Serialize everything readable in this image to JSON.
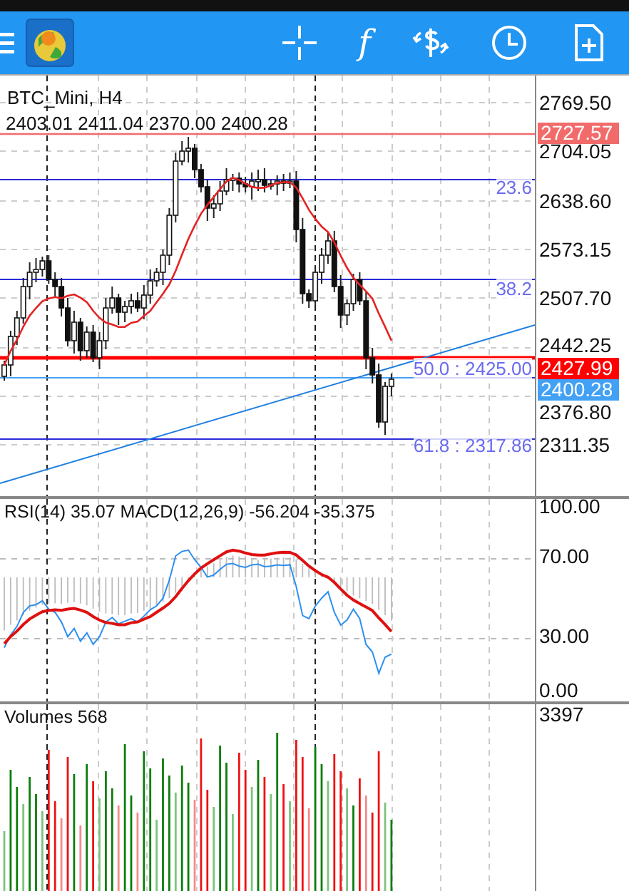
{
  "toolbar": {
    "function_glyph": "f"
  },
  "chart": {
    "symbol": "BTC_Mini, H4",
    "ohlc": "2403.01 2411.04 2370.00 2400.28",
    "price_ticks": [
      "2769.50",
      "2704.05",
      "2638.60",
      "2573.15",
      "2507.70",
      "2442.25",
      "2376.80",
      "2311.35"
    ],
    "price_tags": [
      {
        "text": "2727.57",
        "color": "#f26b6b"
      },
      {
        "text": "2427.99",
        "color": "#ff0000"
      },
      {
        "text": "2400.28",
        "color": "#42a0f5"
      }
    ],
    "fibo_labels": [
      "23.6",
      "38.2",
      "50.0 : 2425.00",
      "61.8 : 2317.86"
    ]
  },
  "oscillator": {
    "label": "RSI(14) 35.07 MACD(12,26,9) -56.204 -35.375",
    "ticks": [
      "100.00",
      "70.00",
      "30.00",
      "0.00"
    ]
  },
  "volumes": {
    "label": "Volumes 568",
    "ticks": [
      "3397"
    ]
  }
}
